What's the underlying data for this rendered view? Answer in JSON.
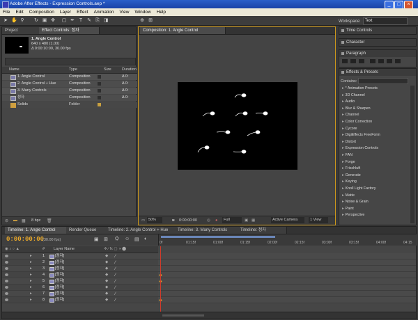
{
  "window": {
    "title": "Adobe After Effects - Expression Controls.aep *"
  },
  "menu": [
    "File",
    "Edit",
    "Composition",
    "Layer",
    "Effect",
    "Animation",
    "View",
    "Window",
    "Help"
  ],
  "workspace": {
    "label": "Workspace:",
    "value": "Text"
  },
  "project": {
    "tab_project": "Project",
    "tab_effect_controls": "Effect Controls: 정자",
    "selected_name": "1. Angle Control",
    "selected_size": "640 x 480 (1.00)",
    "selected_duration": "Δ 0:00:10:00, 30.00 fps",
    "columns": [
      "Name",
      "Type",
      "Size",
      "Duration"
    ],
    "items": [
      {
        "name": "1. Angle Control",
        "type": "Composition",
        "duration": "Δ 0:",
        "kind": "comp",
        "swatch": "dark"
      },
      {
        "name": "2. Angle Control + Hue",
        "type": "Composition",
        "duration": "Δ 0:",
        "kind": "comp",
        "swatch": "dark"
      },
      {
        "name": "3. Many Controls",
        "type": "Composition",
        "duration": "Δ 0:",
        "kind": "comp",
        "swatch": "dark"
      },
      {
        "name": "정자",
        "type": "Composition",
        "duration": "Δ 0:",
        "kind": "comp",
        "swatch": "dark"
      },
      {
        "name": "Solids",
        "type": "Folder",
        "duration": "",
        "kind": "folder",
        "swatch": "gold"
      }
    ],
    "bpc": "8 bpc"
  },
  "composition": {
    "tab": "Composition: 1. Angle Control",
    "zoom": "50%",
    "timecode": "0:00:00:00",
    "resolution": "Full",
    "camera": "Active Camera",
    "view": "1 View"
  },
  "right_panels": {
    "time_controls": "Time Controls",
    "character": "Character",
    "paragraph": "Paragraph",
    "effects": "Effects & Presets",
    "contains": "Contains:",
    "categories": [
      "* Animation Presets",
      "3D Channel",
      "Audio",
      "Blur & Sharpen",
      "Channel",
      "Color Correction",
      "Cycore",
      "DigiEffects FreeForm",
      "Distort",
      "Expression Controls",
      "FAN",
      "Forge",
      "Frischluft",
      "Generate",
      "Keying",
      "Knoll Light Factory",
      "Matte",
      "Noise & Grain",
      "Paint",
      "Perspective"
    ]
  },
  "timeline": {
    "tabs": [
      "Timeline: 1. Angle Control",
      "Render Queue",
      "Timeline: 2. Angle Control + Hue",
      "Timeline: 3. Many Controls",
      "Timeline: 정자"
    ],
    "timecode": "0:00:00:00",
    "fps": "(30.00 fps)",
    "col_layer_name": "Layer Name",
    "col_num": "#",
    "ruler": [
      "0f",
      "01:15f",
      "01:00f",
      "01:15f",
      "02:00f",
      "02:15f",
      "03:00f",
      "03:15f",
      "04:00f",
      "04:15"
    ],
    "layers": [
      {
        "num": "1",
        "name": "[정자]"
      },
      {
        "num": "2",
        "name": "[정자]"
      },
      {
        "num": "3",
        "name": "[정자]"
      },
      {
        "num": "4",
        "name": "[정자]"
      },
      {
        "num": "5",
        "name": "[정자]"
      },
      {
        "num": "6",
        "name": "[정자]"
      },
      {
        "num": "7",
        "name": "[정자]"
      },
      {
        "num": "8",
        "name": "[정자]"
      }
    ]
  }
}
